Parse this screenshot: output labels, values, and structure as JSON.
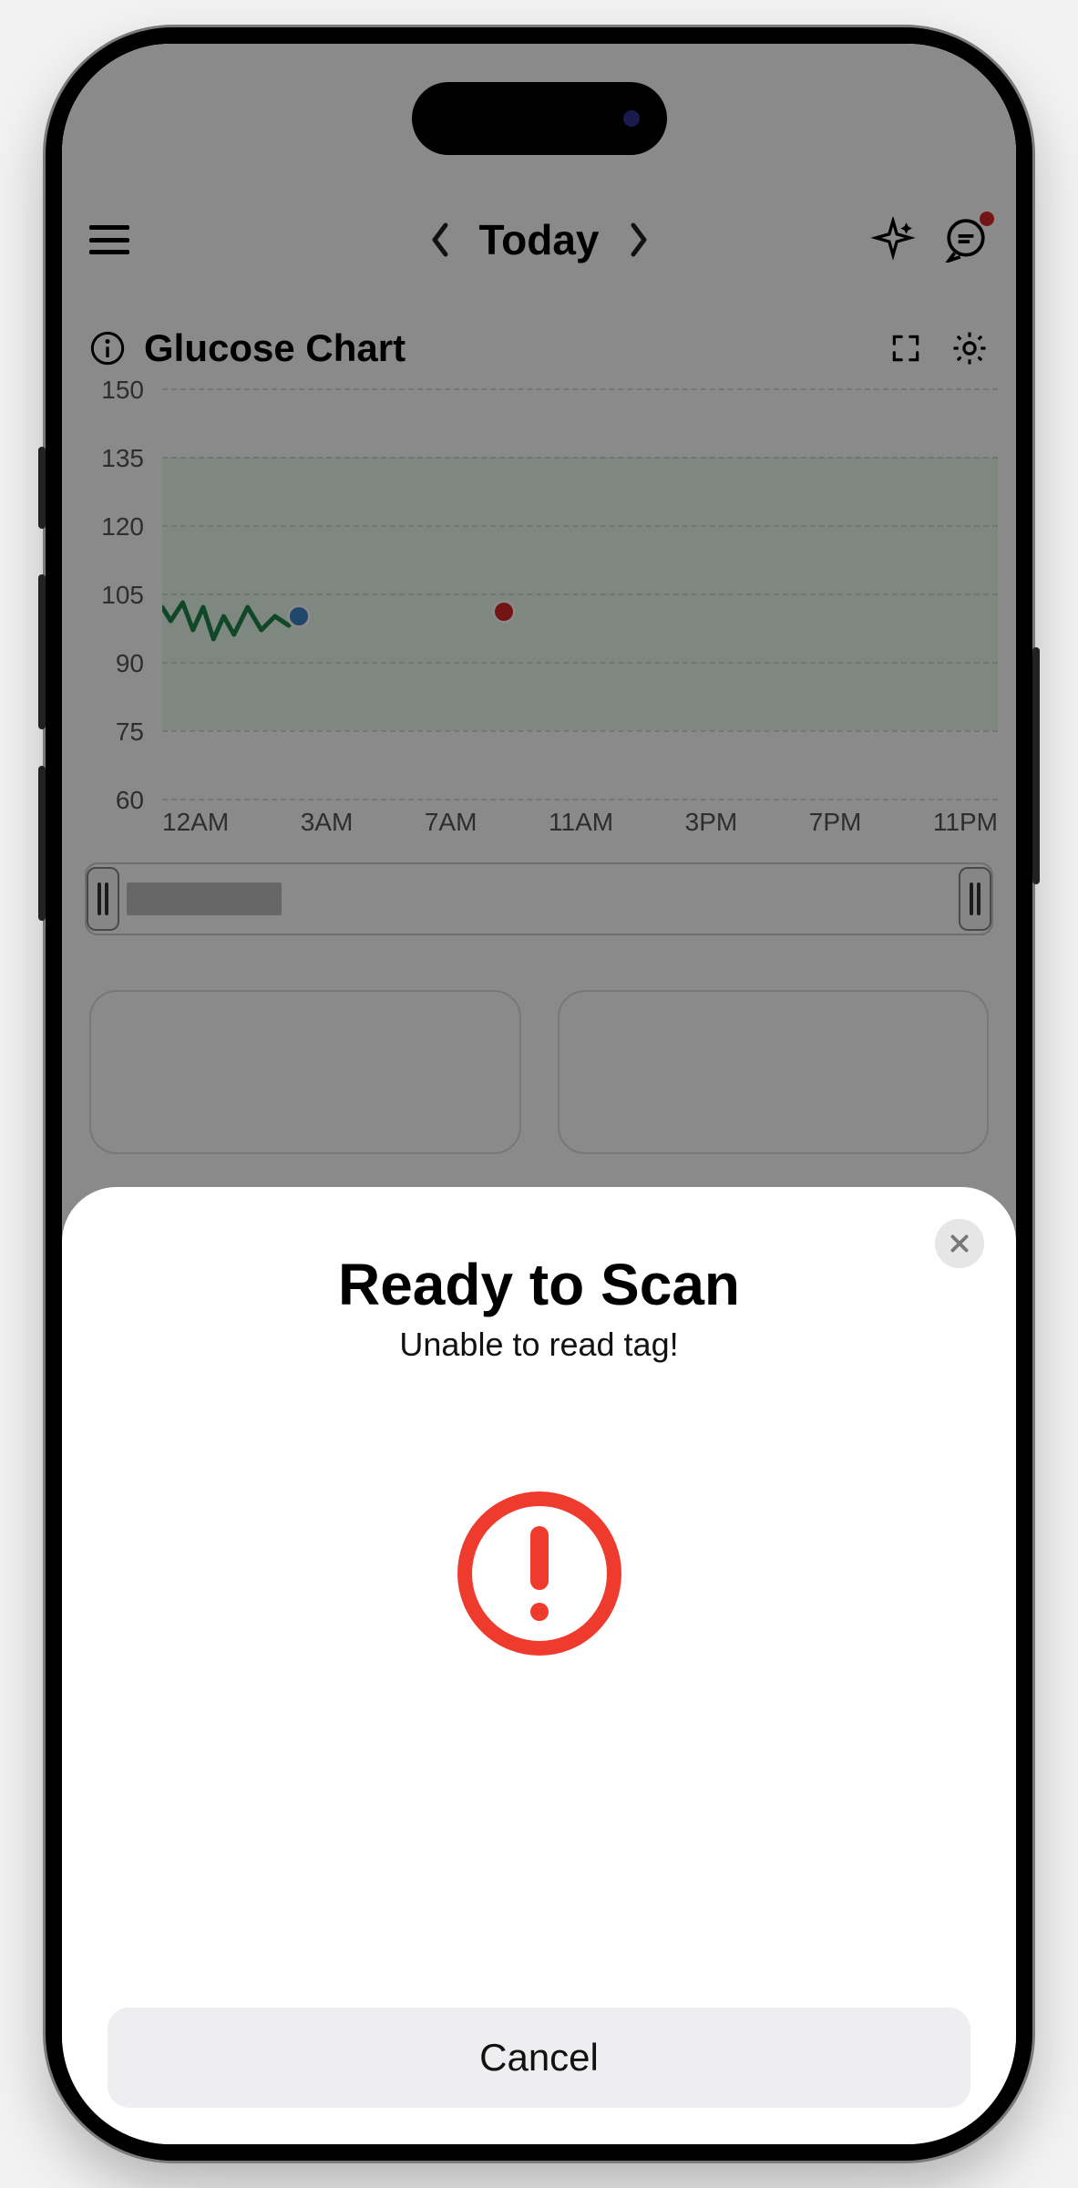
{
  "header": {
    "title": "Today",
    "icons": {
      "menu": "menu-icon",
      "prev": "chevron-left-icon",
      "next": "chevron-right-icon",
      "sparkle": "sparkle-icon",
      "chat": "chat-icon"
    }
  },
  "section": {
    "title": "Glucose Chart",
    "icons": {
      "info": "info-icon",
      "expand": "expand-icon",
      "settings": "gear-icon"
    }
  },
  "chart_data": {
    "type": "line",
    "title": "Glucose Chart",
    "xlabel": "",
    "ylabel": "",
    "ylim": [
      60,
      150
    ],
    "y_ticks": [
      150,
      135,
      120,
      105,
      90,
      75,
      60
    ],
    "categories": [
      "12AM",
      "3AM",
      "7AM",
      "11AM",
      "3PM",
      "7PM",
      "11PM"
    ],
    "target_range": [
      75,
      135
    ],
    "series": [
      {
        "name": "glucose_line",
        "color": "#1e8449",
        "x": [
          0,
          0.25,
          0.6,
          0.9,
          1.2,
          1.5,
          1.8,
          2.1,
          2.5,
          2.9,
          3.3,
          3.7,
          4.0
        ],
        "values": [
          102,
          99,
          103,
          97,
          102,
          95,
          100,
          96,
          102,
          97,
          100,
          98,
          100
        ]
      }
    ],
    "markers": [
      {
        "name": "cgm_point",
        "x_hour": 4.0,
        "y": 100,
        "color": "#3b82c4"
      },
      {
        "name": "event_point",
        "x_hour": 10.0,
        "y": 101,
        "color": "#d62828"
      }
    ]
  },
  "modal": {
    "title": "Ready to Scan",
    "subtitle": "Unable to read tag!",
    "cancel_label": "Cancel"
  }
}
